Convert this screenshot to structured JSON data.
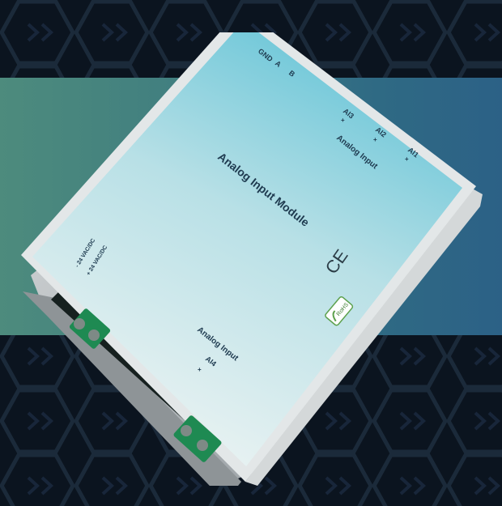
{
  "device": {
    "title": "Analog Input Module",
    "comm_terminals": {
      "gnd": "GND",
      "a": "A",
      "b": "B"
    },
    "analog_inputs_top": {
      "group_label": "Analog Input",
      "channels": [
        "AI3",
        "AI2",
        "AI1"
      ]
    },
    "analog_input_bottom": {
      "group_label": "Analog Input",
      "channel": "AI4"
    },
    "power": {
      "line1": "- 24 VAC/DC",
      "line2": "+ 24 VAC/DC"
    },
    "ce_mark": "CE",
    "rohs_mark": "RoHS",
    "polarity": {
      "plus": "+",
      "minus": "-"
    }
  },
  "colors": {
    "background": "#0b141f",
    "band_left": "#4d8b7d",
    "band_right": "#2c6186",
    "panel_top": "#5fc2d6",
    "panel_bottom": "#e8f1f3",
    "terminal_green": "#1e8a52"
  }
}
